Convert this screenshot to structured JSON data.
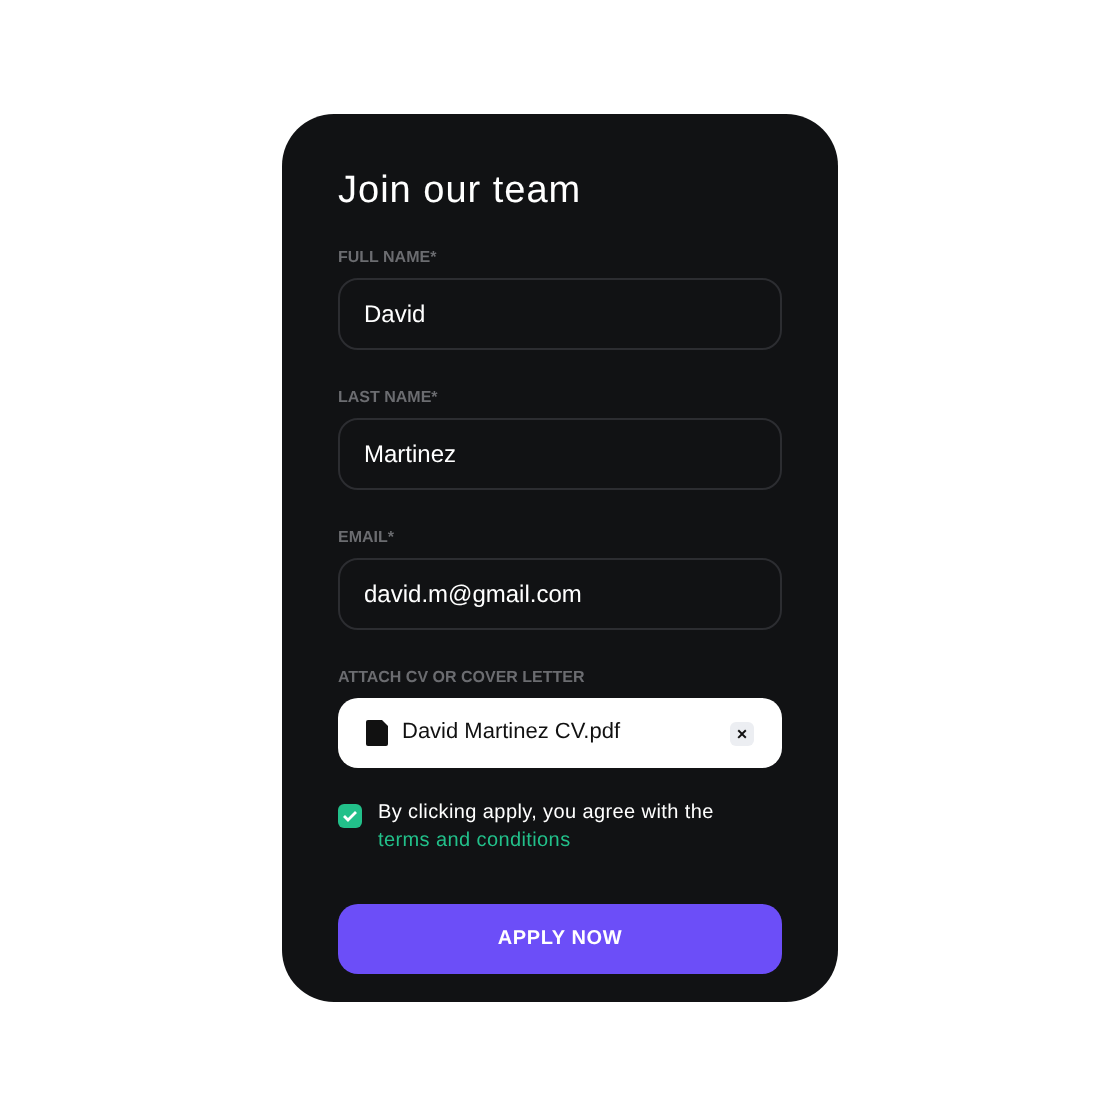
{
  "title": "Join our team",
  "fields": [
    {
      "label": "FULL NAME*",
      "value": "David"
    },
    {
      "label": "LAST NAME*",
      "value": "Martinez"
    },
    {
      "label": "EMAIL*",
      "value": "david.m@gmail.com"
    }
  ],
  "attachment": {
    "label": "ATTACH CV OR COVER LETTER",
    "file_name": "David Martinez CV.pdf",
    "remove": "×"
  },
  "agreement": {
    "checked": true,
    "text": "By clicking apply, you agree with the",
    "link": "terms and conditions"
  },
  "submit": "APPLY NOW"
}
